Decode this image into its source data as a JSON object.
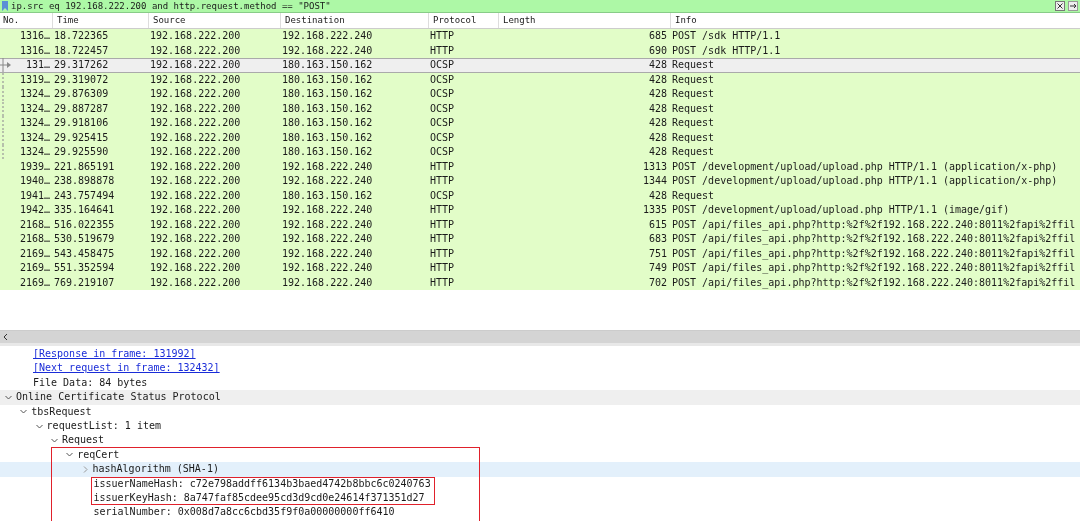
{
  "filter_bar": {
    "text": "ip.src eq 192.168.222.200 and http.request.method == \"POST\""
  },
  "packet_list": {
    "columns": [
      "No.",
      "Time",
      "Source",
      "Destination",
      "Protocol",
      "Length",
      "Info"
    ],
    "rows": [
      {
        "no": "1316…",
        "time": "18.722365",
        "source": "192.168.222.200",
        "destination": "192.168.222.240",
        "protocol": "HTTP",
        "length": "685",
        "info": "POST /sdk HTTP/1.1",
        "selected": false,
        "related": false
      },
      {
        "no": "1316…",
        "time": "18.722457",
        "source": "192.168.222.200",
        "destination": "192.168.222.240",
        "protocol": "HTTP",
        "length": "690",
        "info": "POST /sdk HTTP/1.1",
        "selected": false,
        "related": false
      },
      {
        "no": "131…",
        "time": "29.317262",
        "source": "192.168.222.200",
        "destination": "180.163.150.162",
        "protocol": "OCSP",
        "length": "428",
        "info": "Request",
        "selected": true,
        "related": true
      },
      {
        "no": "1319…",
        "time": "29.319072",
        "source": "192.168.222.200",
        "destination": "180.163.150.162",
        "protocol": "OCSP",
        "length": "428",
        "info": "Request",
        "selected": false,
        "related": true
      },
      {
        "no": "1324…",
        "time": "29.876309",
        "source": "192.168.222.200",
        "destination": "180.163.150.162",
        "protocol": "OCSP",
        "length": "428",
        "info": "Request",
        "selected": false,
        "related": true
      },
      {
        "no": "1324…",
        "time": "29.887287",
        "source": "192.168.222.200",
        "destination": "180.163.150.162",
        "protocol": "OCSP",
        "length": "428",
        "info": "Request",
        "selected": false,
        "related": true
      },
      {
        "no": "1324…",
        "time": "29.918106",
        "source": "192.168.222.200",
        "destination": "180.163.150.162",
        "protocol": "OCSP",
        "length": "428",
        "info": "Request",
        "selected": false,
        "related": true
      },
      {
        "no": "1324…",
        "time": "29.925415",
        "source": "192.168.222.200",
        "destination": "180.163.150.162",
        "protocol": "OCSP",
        "length": "428",
        "info": "Request",
        "selected": false,
        "related": true
      },
      {
        "no": "1324…",
        "time": "29.925590",
        "source": "192.168.222.200",
        "destination": "180.163.150.162",
        "protocol": "OCSP",
        "length": "428",
        "info": "Request",
        "selected": false,
        "related": true
      },
      {
        "no": "1939…",
        "time": "221.865191",
        "source": "192.168.222.200",
        "destination": "192.168.222.240",
        "protocol": "HTTP",
        "length": "1313",
        "info": "POST /development/upload/upload.php HTTP/1.1  (application/x-php)",
        "selected": false,
        "related": false
      },
      {
        "no": "1940…",
        "time": "238.898878",
        "source": "192.168.222.200",
        "destination": "192.168.222.240",
        "protocol": "HTTP",
        "length": "1344",
        "info": "POST /development/upload/upload.php HTTP/1.1  (application/x-php)",
        "selected": false,
        "related": false
      },
      {
        "no": "1941…",
        "time": "243.757494",
        "source": "192.168.222.200",
        "destination": "180.163.150.162",
        "protocol": "OCSP",
        "length": "428",
        "info": "Request",
        "selected": false,
        "related": false
      },
      {
        "no": "1942…",
        "time": "335.164641",
        "source": "192.168.222.200",
        "destination": "192.168.222.240",
        "protocol": "HTTP",
        "length": "1335",
        "info": "POST /development/upload/upload.php HTTP/1.1  (image/gif)",
        "selected": false,
        "related": false
      },
      {
        "no": "2168…",
        "time": "516.022355",
        "source": "192.168.222.200",
        "destination": "192.168.222.240",
        "protocol": "HTTP",
        "length": "615",
        "info": "POST /api/files_api.php?http:%2f%2f192.168.222.240:8011%2fapi%2ffil",
        "selected": false,
        "related": false
      },
      {
        "no": "2168…",
        "time": "530.519679",
        "source": "192.168.222.200",
        "destination": "192.168.222.240",
        "protocol": "HTTP",
        "length": "683",
        "info": "POST /api/files_api.php?http:%2f%2f192.168.222.240:8011%2fapi%2ffil",
        "selected": false,
        "related": false
      },
      {
        "no": "2169…",
        "time": "543.458475",
        "source": "192.168.222.200",
        "destination": "192.168.222.240",
        "protocol": "HTTP",
        "length": "751",
        "info": "POST /api/files_api.php?http:%2f%2f192.168.222.240:8011%2fapi%2ffil",
        "selected": false,
        "related": false
      },
      {
        "no": "2169…",
        "time": "551.352594",
        "source": "192.168.222.200",
        "destination": "192.168.222.240",
        "protocol": "HTTP",
        "length": "749",
        "info": "POST /api/files_api.php?http:%2f%2f192.168.222.240:8011%2fapi%2ffil",
        "selected": false,
        "related": false
      },
      {
        "no": "2169…",
        "time": "769.219107",
        "source": "192.168.222.200",
        "destination": "192.168.222.240",
        "protocol": "HTTP",
        "length": "702",
        "info": "POST /api/files_api.php?http:%2f%2f192.168.222.240:8011%2fapi%2ffil",
        "selected": false,
        "related": false
      }
    ]
  },
  "detail": {
    "lines": [
      {
        "kind": "link",
        "text": "[Response in frame: 131992]"
      },
      {
        "kind": "link",
        "text": "[Next request in frame: 132432]"
      },
      {
        "kind": "text",
        "text": "File Data: 84 bytes"
      }
    ],
    "tree": [
      {
        "label": "Online Certificate Status Protocol",
        "expanded": true,
        "shaded": true,
        "selected": false,
        "outlined": false,
        "marked": false,
        "children": [
          {
            "label": "tbsRequest",
            "expanded": true,
            "shaded": false,
            "selected": false,
            "outlined": false,
            "marked": false,
            "children": [
              {
                "label": "requestList: 1 item",
                "expanded": true,
                "shaded": false,
                "selected": false,
                "outlined": false,
                "marked": false,
                "children": [
                  {
                    "label": "Request",
                    "expanded": true,
                    "shaded": false,
                    "selected": false,
                    "outlined": false,
                    "marked": false,
                    "children": [
                      {
                        "label": "reqCert",
                        "expanded": true,
                        "shaded": false,
                        "selected": false,
                        "outlined": true,
                        "marked": false,
                        "children": [
                          {
                            "label": "hashAlgorithm (SHA-1)",
                            "expanded": false,
                            "shaded": false,
                            "selected": true,
                            "outlined": false,
                            "marked": false
                          },
                          {
                            "label": "issuerNameHash: c72e798addff6134b3baed4742b8bbc6c0240763",
                            "shaded": false,
                            "selected": false,
                            "outlined": false,
                            "marked": true
                          },
                          {
                            "label": "issuerKeyHash: 8a747faf85cdee95cd3d9cd0e24614f371351d27",
                            "shaded": false,
                            "selected": false,
                            "outlined": false,
                            "marked": true
                          },
                          {
                            "label": "serialNumber: 0x008d7a8cc6cbd35f9f0a00000000ff6410",
                            "shaded": false,
                            "selected": false,
                            "outlined": false,
                            "marked": false
                          }
                        ]
                      }
                    ]
                  }
                ]
              }
            ]
          }
        ]
      }
    ]
  }
}
